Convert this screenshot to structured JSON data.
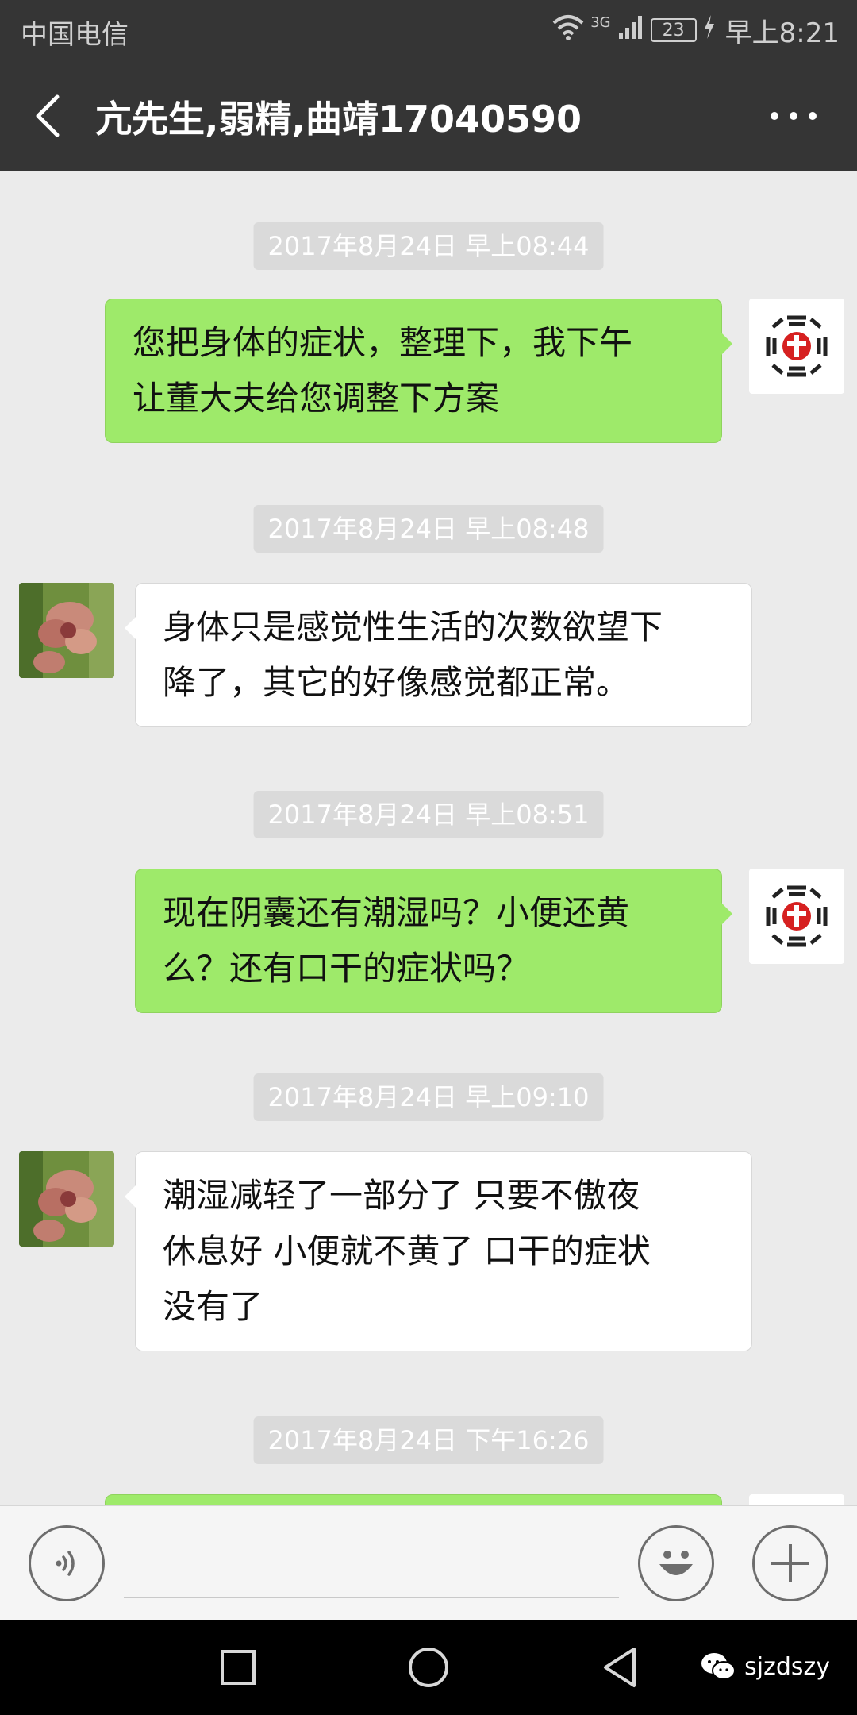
{
  "status_bar": {
    "carrier": "中国电信",
    "network": "3G",
    "battery": "23",
    "time": "早上8:21"
  },
  "header": {
    "title": "亢先生,弱精,曲靖17040590",
    "back_icon": "chevron-left-icon",
    "more_icon": "more-dots-icon"
  },
  "messages": [
    {
      "timestamp": "2017年8月24日 早上08:44",
      "direction": "out",
      "lines": [
        "您把身体的症状，整理下，我下午",
        "让董大夫给您调整下方案"
      ]
    },
    {
      "timestamp": "2017年8月24日 早上08:48",
      "direction": "in",
      "lines": [
        "身体只是感觉性生活的次数欲望下",
        "降了，其它的好像感觉都正常。"
      ]
    },
    {
      "timestamp": "2017年8月24日 早上08:51",
      "direction": "out",
      "lines": [
        "现在阴囊还有潮湿吗？小便还黄",
        "么？还有口干的症状吗？"
      ]
    },
    {
      "timestamp": "2017年8月24日 早上09:10",
      "direction": "in",
      "lines": [
        "潮湿减轻了一部分了  只要不傲夜",
        "休息好 小便就不黄了 口干的症状",
        "没有了"
      ]
    },
    {
      "timestamp": "2017年8月24日 下午16:26",
      "direction": "out",
      "lines": []
    }
  ],
  "input_bar": {
    "voice_icon": "voice-icon",
    "emoji_icon": "emoji-icon",
    "add_icon": "plus-icon",
    "text_value": ""
  },
  "nav_bar": {
    "watermark": "sjzdszy"
  },
  "colors": {
    "header_bg": "#353535",
    "chat_bg": "#ebebeb",
    "bubble_out": "#9eea6a",
    "bubble_in": "#ffffff",
    "timestamp_bg": "#dadada"
  }
}
